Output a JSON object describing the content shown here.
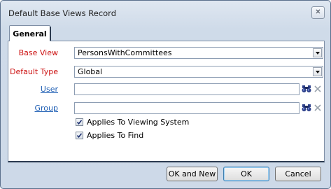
{
  "window": {
    "title": "Default Base Views Record",
    "close_glyph": "✕"
  },
  "tabs": [
    {
      "label": "General",
      "active": true
    }
  ],
  "form": {
    "base_view": {
      "label": "Base View",
      "value": "PersonsWithCommittees"
    },
    "default_type": {
      "label": "Default Type",
      "value": "Global"
    },
    "user": {
      "label": "User",
      "value": ""
    },
    "group": {
      "label": "Group",
      "value": ""
    },
    "applies_viewing": {
      "label": "Applies To Viewing System",
      "checked": true
    },
    "applies_find": {
      "label": "Applies To Find",
      "checked": true
    }
  },
  "buttons": {
    "ok_and_new": "OK and New",
    "ok": "OK",
    "cancel": "Cancel"
  },
  "colors": {
    "required_label": "#cc1111",
    "link_label": "#1f5fb4",
    "window_bg": "#cfdbe9"
  },
  "icons": {
    "lookup": "binoculars-icon",
    "clear": "clear-x-icon",
    "dropdown": "dropdown-arrow-icon",
    "check": "checkmark-icon"
  }
}
